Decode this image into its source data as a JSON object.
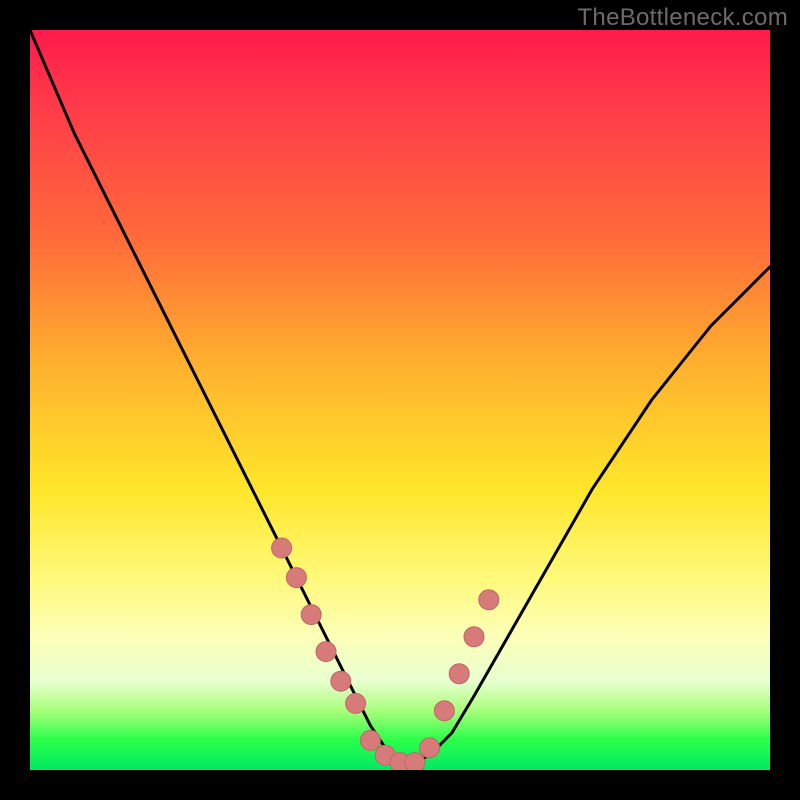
{
  "watermark": "TheBottleneck.com",
  "colors": {
    "frame": "#000000",
    "curve_stroke": "#000000",
    "marker_fill": "#d77a7a",
    "marker_stroke": "#c06666",
    "gradient_stops": [
      "#ff1a4a",
      "#ff3a4a",
      "#ff6a3a",
      "#ffb02e",
      "#ffe629",
      "#fff97a",
      "#fcffb8",
      "#e8ffd0",
      "#a8ff7a",
      "#2aff4a",
      "#00e864"
    ]
  },
  "chart_data": {
    "type": "line",
    "title": "",
    "xlabel": "",
    "ylabel": "",
    "xlim": [
      0,
      100
    ],
    "ylim": [
      0,
      100
    ],
    "grid": false,
    "note": "Image has no visible axis tick labels; x and y are normalized 0–100 percent of plot area. y=0 is bottom (green), y=100 is top (red).",
    "series": [
      {
        "name": "bottleneck-curve",
        "x": [
          0,
          3,
          6,
          10,
          14,
          18,
          22,
          26,
          30,
          33,
          36,
          39,
          42,
          44,
          46,
          48,
          50,
          52,
          54,
          57,
          60,
          64,
          68,
          72,
          76,
          80,
          84,
          88,
          92,
          96,
          100
        ],
        "values": [
          100,
          93,
          86,
          78,
          70,
          62,
          54,
          46,
          38,
          32,
          26,
          20,
          14,
          10,
          6,
          3,
          1,
          1,
          2,
          5,
          10,
          17,
          24,
          31,
          38,
          44,
          50,
          55,
          60,
          64,
          68
        ]
      }
    ],
    "markers": {
      "name": "highlighted-points",
      "note": "Salmon circular markers clustered near the valley bottom on both arms of the curve.",
      "x": [
        34,
        36,
        38,
        40,
        42,
        44,
        46,
        48,
        50,
        52,
        54,
        56,
        58,
        60,
        62
      ],
      "values": [
        30,
        26,
        21,
        16,
        12,
        9,
        4,
        2,
        1,
        1,
        3,
        8,
        13,
        18,
        23
      ]
    }
  }
}
